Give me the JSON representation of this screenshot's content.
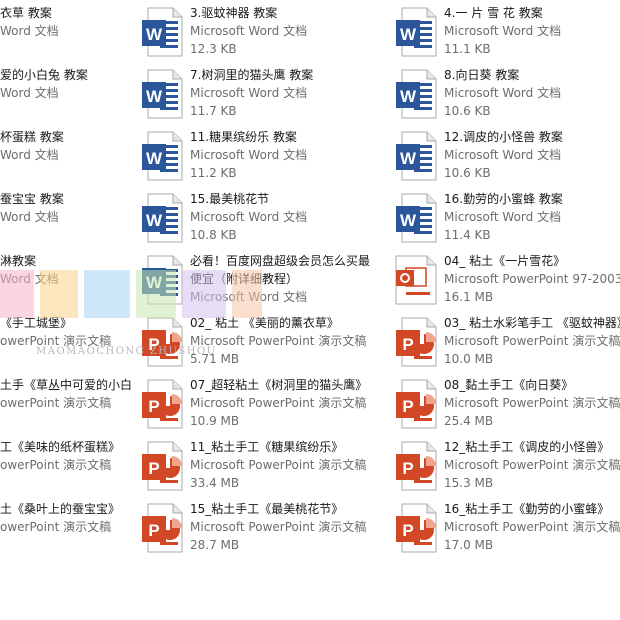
{
  "watermark": {
    "text": "MAOMAOCHONG ZHUSHOU"
  },
  "files": [
    {
      "name": "衣草 教案",
      "type": "Word 文档",
      "size": "",
      "kind": "word",
      "col": 0,
      "row": 0
    },
    {
      "name": "3.驱蚊神器 教案",
      "type": "Microsoft Word 文档",
      "size": "12.3 KB",
      "kind": "word",
      "col": 1,
      "row": 0
    },
    {
      "name": "4.一 片 雪 花 教案",
      "type": "Microsoft Word 文档",
      "size": "11.1 KB",
      "kind": "word",
      "col": 2,
      "row": 0
    },
    {
      "name": "爱的小白兔 教案",
      "type": "Word 文档",
      "size": "",
      "kind": "word",
      "col": 0,
      "row": 1
    },
    {
      "name": "7.树洞里的猫头鹰 教案",
      "type": "Microsoft Word 文档",
      "size": "11.7 KB",
      "kind": "word",
      "col": 1,
      "row": 1
    },
    {
      "name": "8.向日葵  教案",
      "type": "Microsoft Word 文档",
      "size": "10.6 KB",
      "kind": "word",
      "col": 2,
      "row": 1
    },
    {
      "name": "杯蛋糕 教案",
      "type": "Word 文档",
      "size": "",
      "kind": "word",
      "col": 0,
      "row": 2
    },
    {
      "name": "11.糖果缤纷乐 教案",
      "type": "Microsoft Word 文档",
      "size": "11.2 KB",
      "kind": "word",
      "col": 1,
      "row": 2
    },
    {
      "name": "12.调皮的小怪兽 教案",
      "type": "Microsoft Word 文档",
      "size": "10.6 KB",
      "kind": "word",
      "col": 2,
      "row": 2
    },
    {
      "name": "蚕宝宝  教案",
      "type": "Word 文档",
      "size": "",
      "kind": "word",
      "col": 0,
      "row": 3
    },
    {
      "name": "15.最美桃花节",
      "type": "Microsoft Word 文档",
      "size": "10.8 KB",
      "kind": "word",
      "col": 1,
      "row": 3
    },
    {
      "name": "16.勤劳的小蜜蜂 教案",
      "type": "Microsoft Word 文档",
      "size": "11.4 KB",
      "kind": "word",
      "col": 2,
      "row": 3
    },
    {
      "name": "淋教案",
      "type": "Word 文档",
      "size": "",
      "kind": "word",
      "col": 0,
      "row": 4
    },
    {
      "name": "必看！百度网盘超级会员怎么买最便宜（附详细教程）",
      "type": "Microsoft Word 文档",
      "size": "",
      "kind": "word",
      "col": 1,
      "row": 4,
      "wrap": true
    },
    {
      "name": "04_ 粘土《一片雪花》",
      "type": "Microsoft PowerPoint 97-2003",
      "size": "16.1 MB",
      "kind": "ppt97",
      "col": 2,
      "row": 4
    },
    {
      "name": "《手工城堡》",
      "type": "owerPoint 演示文稿",
      "size": "",
      "kind": "ppt",
      "col": 0,
      "row": 5
    },
    {
      "name": "02_ 粘土 《美丽的薰衣草》",
      "type": "Microsoft PowerPoint 演示文稿",
      "size": "5.71 MB",
      "kind": "ppt",
      "col": 1,
      "row": 5
    },
    {
      "name": "03_ 粘土水彩笔手工 《驱蚊神器》",
      "type": "Microsoft PowerPoint 演示文稿",
      "size": "10.0 MB",
      "kind": "ppt",
      "col": 2,
      "row": 5
    },
    {
      "name": "土手《草丛中可爱的小白",
      "type": "owerPoint 演示文稿",
      "size": "",
      "kind": "ppt",
      "col": 0,
      "row": 6
    },
    {
      "name": "07_超轻粘土《树洞里的猫头鹰》",
      "type": "Microsoft PowerPoint 演示文稿",
      "size": "10.9 MB",
      "kind": "ppt",
      "col": 1,
      "row": 6
    },
    {
      "name": "08_黏土手工《向日葵》",
      "type": "Microsoft PowerPoint 演示文稿",
      "size": "25.4 MB",
      "kind": "ppt",
      "col": 2,
      "row": 6
    },
    {
      "name": "工《美味的纸杯蛋糕》",
      "type": "owerPoint 演示文稿",
      "size": "",
      "kind": "ppt",
      "col": 0,
      "row": 7
    },
    {
      "name": "11_粘土手工《糖果缤纷乐》",
      "type": "Microsoft PowerPoint 演示文稿",
      "size": "33.4 MB",
      "kind": "ppt",
      "col": 1,
      "row": 7
    },
    {
      "name": "12_粘土手工《调皮的小怪兽》",
      "type": "Microsoft PowerPoint 演示文稿",
      "size": "15.3 MB",
      "kind": "ppt",
      "col": 2,
      "row": 7
    },
    {
      "name": "土《桑叶上的蚕宝宝》",
      "type": "owerPoint 演示文稿",
      "size": "",
      "kind": "ppt",
      "col": 0,
      "row": 8
    },
    {
      "name": "15_粘土手工《最美桃花节》",
      "type": "Microsoft PowerPoint 演示文稿",
      "size": "28.7 MB",
      "kind": "ppt",
      "col": 1,
      "row": 8
    },
    {
      "name": "16_粘土手工《勤劳的小蜜蜂》",
      "type": "Microsoft PowerPoint 演示文稿",
      "size": "17.0 MB",
      "kind": "ppt",
      "col": 2,
      "row": 8
    }
  ]
}
